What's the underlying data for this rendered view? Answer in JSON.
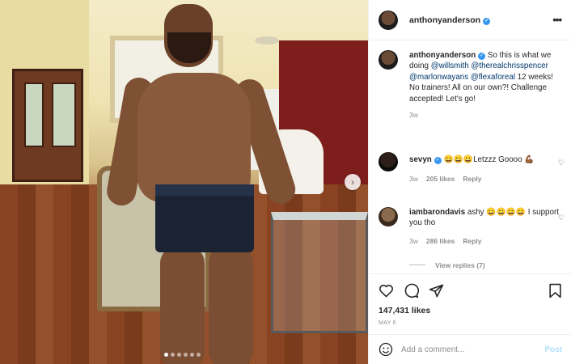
{
  "post": {
    "username": "anthonyanderson",
    "more_icon": "more-horizontal-icon",
    "caption": {
      "username": "anthonyanderson",
      "text_1": " So this is what we doing ",
      "m1": "@willsmith",
      "m2": "@therealchrisspencer",
      "m3": "@marlonwayans",
      "m4": "@flexaforeal",
      "text_2": " 12 weeks! No trainers! All on our own?! Challenge accepted! Let's go!",
      "time": "3w"
    },
    "comments": [
      {
        "username": "sevyn",
        "text": " 😀😀😀Letzzz Goooo 💪🏾",
        "time": "3w",
        "likes": "205 likes",
        "reply": "Reply"
      },
      {
        "username": "iambarondavis",
        "text": " ashy 😀😀😀😀 I support you tho",
        "time": "3w",
        "likes": "286 likes",
        "reply": "Reply",
        "view_replies": "View replies (7)"
      }
    ],
    "likes_count": "147,431 likes",
    "date": "MAY 6",
    "comment_placeholder": "Add a comment...",
    "post_button": "Post",
    "carousel": {
      "total": 6,
      "active": 0
    }
  },
  "colors": {
    "verified": "#3897f0",
    "post_button": "#b2dffc",
    "mention": "#00376b"
  }
}
